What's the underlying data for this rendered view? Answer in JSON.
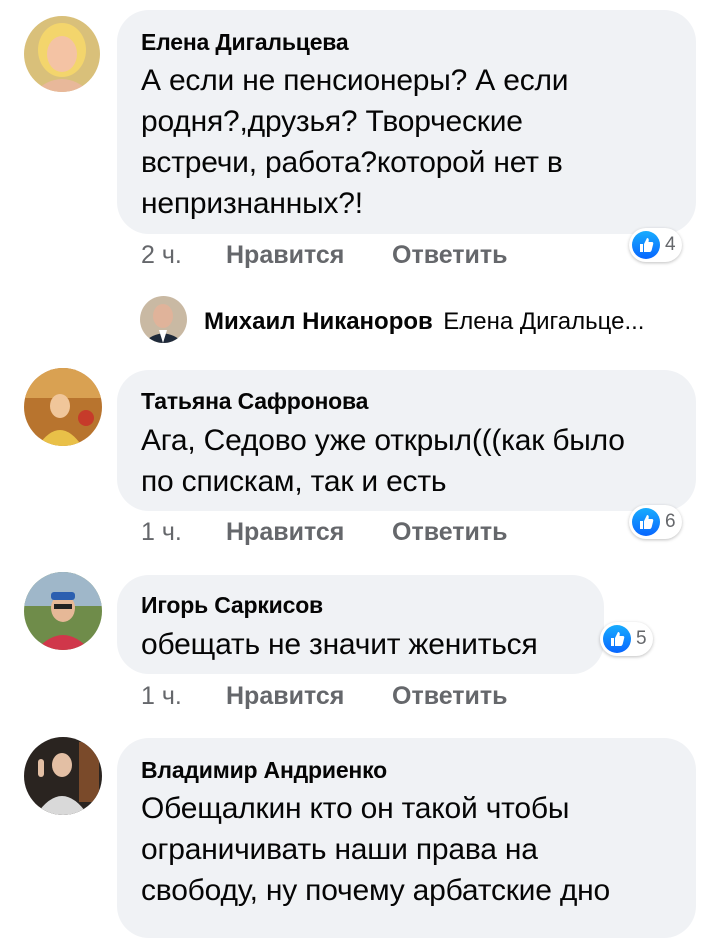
{
  "comments": [
    {
      "author": "Елена Дигальцева",
      "text": "А если не пенсионеры? А если\nродня?,друзья? Творческие\nвстречи, работа?которой нет в\nнепризнанных?!",
      "time": "2 ч.",
      "like_label": "Нравится",
      "reply_label": "Ответить",
      "reaction_count": "4"
    },
    {
      "author": "Татьяна Сафронова",
      "text": "Ага, Седово уже открыл(((как было\nпо спискам, так и есть",
      "time": "1 ч.",
      "like_label": "Нравится",
      "reply_label": "Ответить",
      "reaction_count": "6"
    },
    {
      "author": "Игорь Саркисов",
      "text": "обещать не значит жениться",
      "time": "1 ч.",
      "like_label": "Нравится",
      "reply_label": "Ответить",
      "reaction_count": "5"
    },
    {
      "author": "Владимир Андриенко",
      "text": "Обещалкин кто он такой чтобы\nограничивать наши права на\nсвободу, ну почему арбатские дно"
    }
  ],
  "reply": {
    "author": "Михаил Никаноров",
    "preview": "Елена Дигальце..."
  },
  "colors": {
    "bubble": "#f0f2f5",
    "meta": "#65676b",
    "like": "#0866ff"
  }
}
